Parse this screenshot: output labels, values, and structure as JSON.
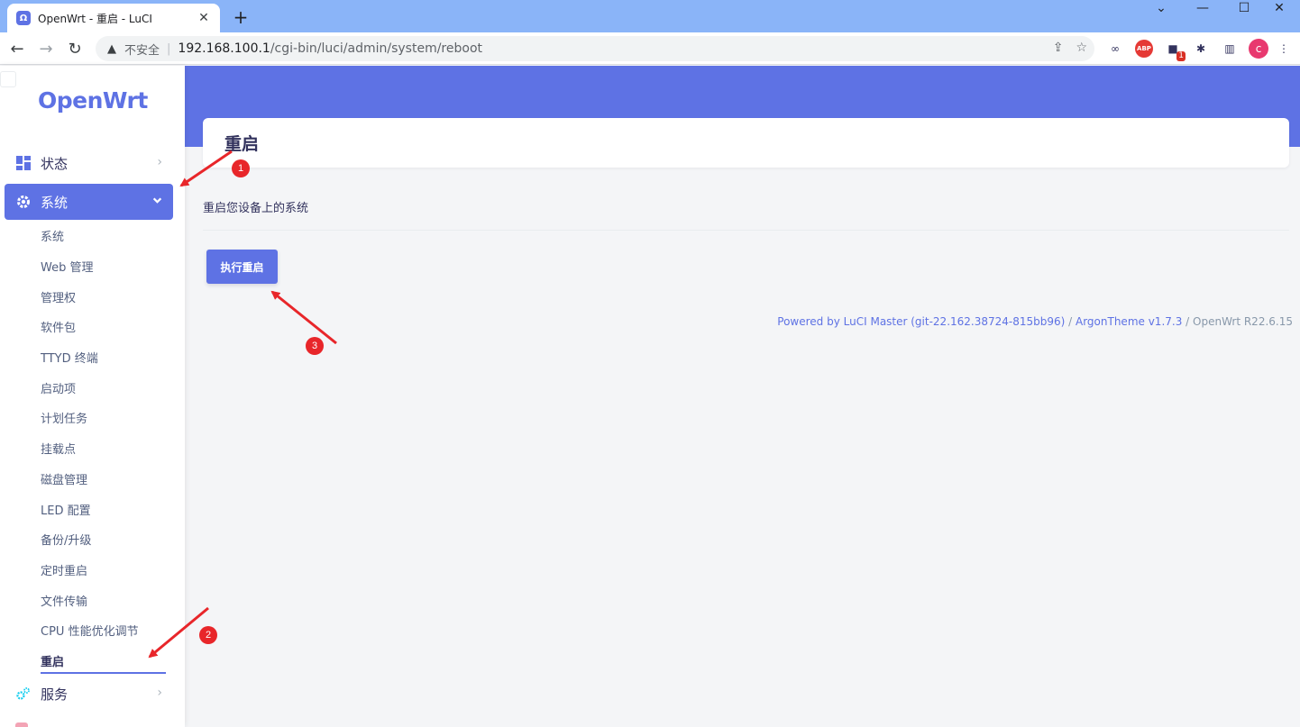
{
  "browser": {
    "tab_title": "OpenWrt - 重启 - LuCI",
    "tab_close": "✕",
    "new_tab": "+",
    "favicon_icon": "openwrt-favicon",
    "insecure_label": "不安全",
    "url_host": "192.168.100.1",
    "url_path": "/cgi-bin/luci/admin/system/reboot",
    "profile_initial": "c",
    "ext_abp": "ABP",
    "ext_badge": "1"
  },
  "brand": "OpenWrt",
  "menu": {
    "status": "状态",
    "system": "系统",
    "services": "服务"
  },
  "submenu": [
    "系统",
    "Web 管理",
    "管理权",
    "软件包",
    "TTYD 终端",
    "启动项",
    "计划任务",
    "挂载点",
    "磁盘管理",
    "LED 配置",
    "备份/升级",
    "定时重启",
    "文件传输",
    "CPU 性能优化调节",
    "重启"
  ],
  "main": {
    "title": "重启",
    "description": "重启您设备上的系统",
    "reboot_button": "执行重启"
  },
  "footer": {
    "luci": "Powered by LuCI Master (git-22.162.38724-815bb96)",
    "slash1": " / ",
    "theme": "ArgonTheme v1.7.3",
    "slash2": " / ",
    "version": "OpenWrt R22.6.15"
  },
  "annotations": [
    "1",
    "2",
    "3"
  ],
  "colors": {
    "accent": "#5e72e4",
    "annotation": "#e8262a",
    "tabbar": "#8ab4f8"
  }
}
